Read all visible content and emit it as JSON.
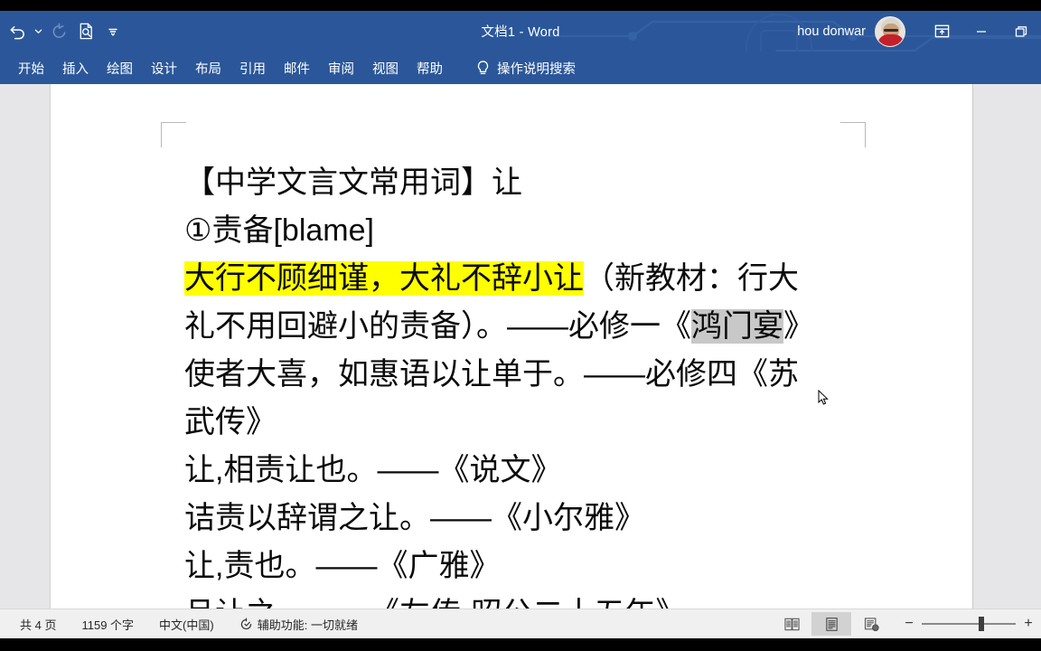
{
  "window": {
    "title": "文档1  -  Word",
    "account_name": "hou donwar",
    "ribbon_display_icon": "ribbon-display-options-icon",
    "minimize_icon": "minimize-icon",
    "restore_icon": "restore-down-icon"
  },
  "quick_access": {
    "undo": "undo-icon",
    "undo_dropdown": "chevron-down-icon",
    "redo": "redo-icon",
    "print_preview": "print-preview-icon",
    "customize": "customize-quick-access-toolbar-icon"
  },
  "ribbon": {
    "tabs": [
      {
        "label": "开始"
      },
      {
        "label": "插入"
      },
      {
        "label": "绘图"
      },
      {
        "label": "设计"
      },
      {
        "label": "布局"
      },
      {
        "label": "引用"
      },
      {
        "label": "邮件"
      },
      {
        "label": "审阅"
      },
      {
        "label": "视图"
      },
      {
        "label": "帮助"
      }
    ],
    "tell_me": {
      "icon": "lightbulb-icon",
      "label": "操作说明搜索"
    }
  },
  "document": {
    "lines": [
      {
        "segments": [
          {
            "text": "【中学文言文常用词】让",
            "highlight": "none"
          }
        ]
      },
      {
        "segments": [
          {
            "text": "①责备[blame]",
            "highlight": "none"
          }
        ]
      },
      {
        "segments": [
          {
            "text": "大行不顾细谨，大礼不辞小让",
            "highlight": "yellow"
          },
          {
            "text": "（新教材：行大",
            "highlight": "none"
          }
        ]
      },
      {
        "segments": [
          {
            "text": "礼不用回避小的责备）。——必修一《",
            "highlight": "none"
          },
          {
            "text": "鸿门宴",
            "highlight": "gray"
          },
          {
            "text": "》",
            "highlight": "none"
          }
        ]
      },
      {
        "segments": [
          {
            "text": "使者大喜，如惠语以让单于。——必修四《苏",
            "highlight": "none"
          }
        ]
      },
      {
        "segments": [
          {
            "text": "武传》",
            "highlight": "none"
          }
        ]
      },
      {
        "segments": [
          {
            "text": "让,相责让也。——《说文》",
            "highlight": "none"
          }
        ]
      },
      {
        "segments": [
          {
            "text": "诘责以辞谓之让。——《小尔雅》",
            "highlight": "none"
          }
        ]
      },
      {
        "segments": [
          {
            "text": "让,责也。——《广雅》",
            "highlight": "none"
          }
        ]
      },
      {
        "segments": [
          {
            "text": "且让之。——《左传·昭公二十五年》",
            "highlight": "none"
          }
        ]
      }
    ]
  },
  "status_bar": {
    "page_count": "共 4 页",
    "word_count": "1159 个字",
    "language": "中文(中国)",
    "accessibility_icon": "accessibility-checker-icon",
    "accessibility": "辅助功能: 一切就绪",
    "views": [
      {
        "name": "read-mode",
        "active": false
      },
      {
        "name": "print-layout",
        "active": true
      },
      {
        "name": "web-layout",
        "active": false
      }
    ],
    "zoom_out": "−",
    "zoom_in": "+"
  },
  "colors": {
    "ribbon_blue": "#2b579a",
    "highlight_yellow": "#ffff00",
    "selection_gray": "#c8c8c8",
    "page_bg": "#ffffff",
    "canvas_bg": "#e6e6e8"
  }
}
